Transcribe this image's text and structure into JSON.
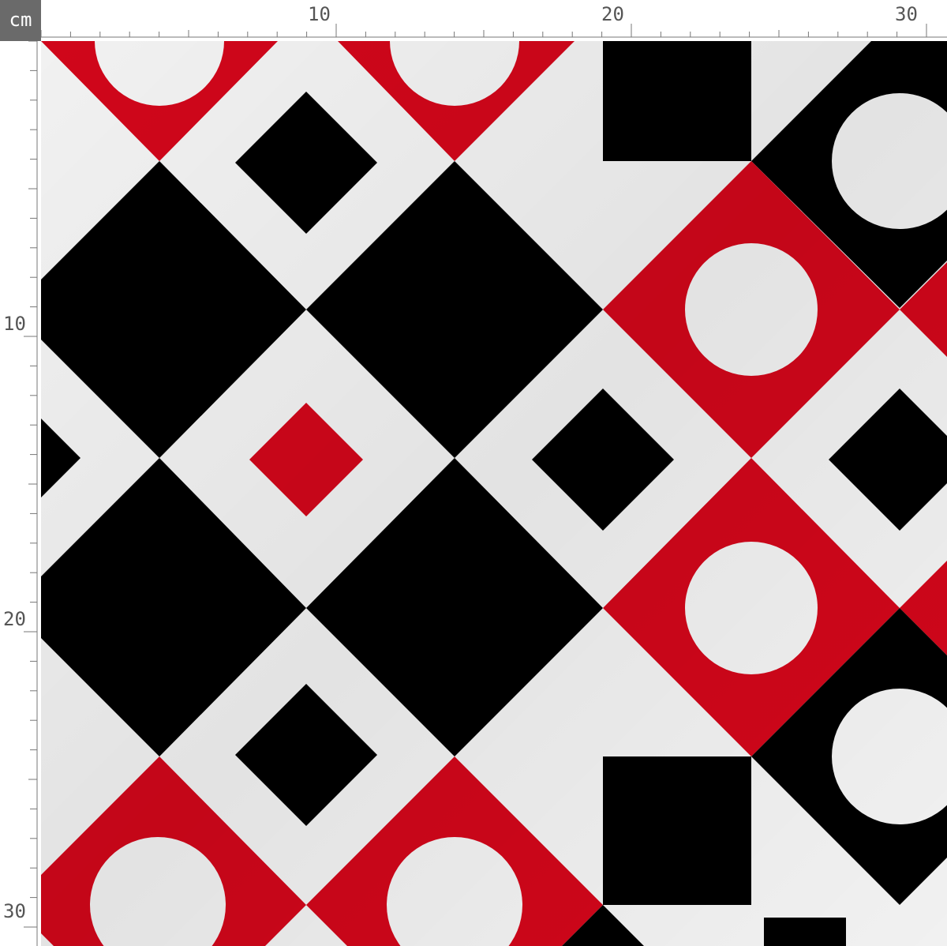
{
  "ruler": {
    "unit": "cm",
    "top_labels": [
      "10",
      "20",
      "30"
    ],
    "left_labels": [
      "10",
      "20",
      "30"
    ]
  },
  "colors": {
    "red": "#d0061a",
    "black": "#000000",
    "white": "#f1f1f1",
    "ruler_text": "#555555",
    "badge_bg": "#6a6a6a"
  }
}
